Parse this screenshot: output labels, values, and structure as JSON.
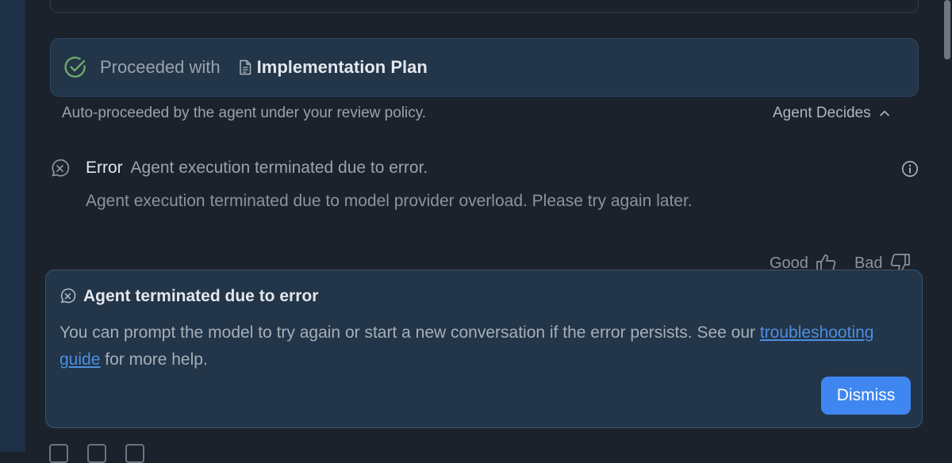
{
  "proceeded": {
    "prefix": "Proceeded with",
    "document": "Implementation Plan",
    "icon": "check-circle-icon",
    "accent": "#6fa86a"
  },
  "auto_note": "Auto-proceeded by the agent under your review policy.",
  "policy_toggle": {
    "label": "Agent Decides",
    "icon": "chevron-up-icon"
  },
  "error": {
    "label": "Error",
    "summary": "Agent execution terminated due to error.",
    "detail": "Agent execution terminated due to model provider overload. Please try again later.",
    "icon": "x-circle-icon"
  },
  "feedback": {
    "good_label": "Good",
    "bad_label": "Bad"
  },
  "dialog": {
    "title": "Agent terminated due to error",
    "body_before": "You can prompt the model to try again or start a new conversation if the error persists. See our",
    "link_text": "troubleshooting guide",
    "body_after": "for more help.",
    "dismiss_label": "Dismiss",
    "button_color": "#3f86f0"
  }
}
